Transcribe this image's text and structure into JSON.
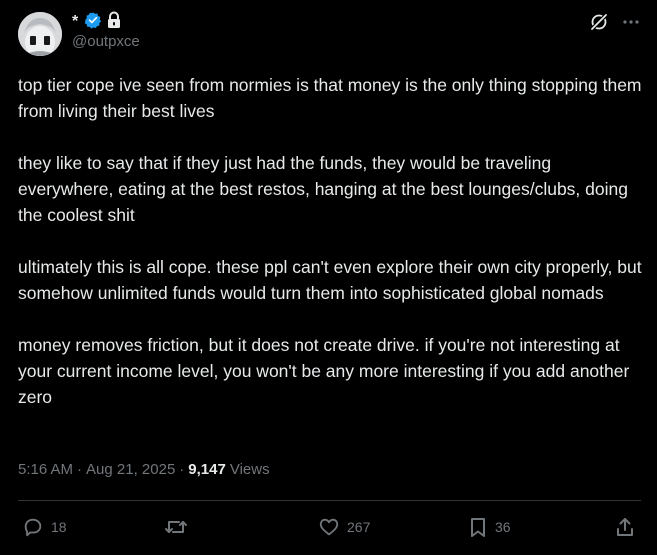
{
  "user": {
    "display_name": "*",
    "handle": "@outpxce",
    "verified_icon": "verified-badge-icon",
    "protected_icon": "lock-icon",
    "badge_color": "#1d9bf0"
  },
  "top_actions": {
    "grok_icon": "grok-icon",
    "more_icon": "more-icon",
    "more_label": "···"
  },
  "tweet": {
    "paragraphs": [
      "top tier cope ive seen from normies is that money is the only thing stopping them from living their best lives",
      "they like to say that if they just had the funds, they would be traveling everywhere, eating at the best restos, hanging at the best lounges/clubs, doing the coolest shit",
      "ultimately this is all cope. these ppl can't even explore their own city properly, but somehow unlimited funds would turn them into sophisticated global nomads",
      "money removes friction, but it does not create drive. if you're not interesting at your current income level, you won't be any more interesting if you add another zero"
    ]
  },
  "meta": {
    "time": "5:16 AM",
    "separator": "·",
    "date": "Aug 21, 2025",
    "views_count": "9,147",
    "views_label": "Views"
  },
  "actions": {
    "replies": "18",
    "retweets": "",
    "likes": "267",
    "bookmarks": "36",
    "reply_icon": "reply-icon",
    "retweet_icon": "retweet-icon",
    "like_icon": "heart-icon",
    "bookmark_icon": "bookmark-icon",
    "share_icon": "share-icon"
  },
  "colors": {
    "background": "#000000",
    "text": "#e7e9ea",
    "muted": "#71767b",
    "divider": "#2f3336",
    "accent": "#1d9bf0"
  }
}
